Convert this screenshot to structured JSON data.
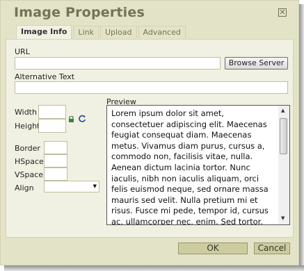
{
  "dialog": {
    "title": "Image Properties",
    "close_icon": "close-icon"
  },
  "tabs": [
    {
      "label": "Image Info",
      "active": true
    },
    {
      "label": "Link",
      "active": false
    },
    {
      "label": "Upload",
      "active": false
    },
    {
      "label": "Advanced",
      "active": false
    }
  ],
  "url": {
    "label": "URL",
    "value": ""
  },
  "browse_server_label": "Browse Server",
  "alt_text": {
    "label": "Alternative Text",
    "value": ""
  },
  "dimensions": {
    "width_label": "Width",
    "height_label": "Height",
    "width_value": "",
    "height_value": "",
    "lock_icon": "lock-icon",
    "reset_icon": "refresh-icon"
  },
  "spacing": {
    "border_label": "Border",
    "hspace_label": "HSpace",
    "vspace_label": "VSpace",
    "align_label": "Align",
    "align_value": ""
  },
  "preview": {
    "label": "Preview",
    "text": "Lorem ipsum dolor sit amet, consectetuer adipiscing elit. Maecenas feugiat consequat diam. Maecenas metus. Vivamus diam purus, cursus a, commodo non, facilisis vitae, nulla. Aenean dictum lacinia tortor. Nunc iaculis, nibh non iaculis aliquam, orci felis euismod neque, sed ornare massa mauris sed velit. Nulla pretium mi et risus. Fusce mi pede, tempor id, cursus ac, ullamcorper nec, enim. Sed tortor. Curabitur molestie. Duis"
  },
  "footer": {
    "ok_label": "OK",
    "cancel_label": "Cancel"
  },
  "colors": {
    "dialog_bg": "#e3e3c7",
    "panel_bg": "#f1f1e3",
    "title": "#737357",
    "button_bg": "#cccc9e"
  }
}
